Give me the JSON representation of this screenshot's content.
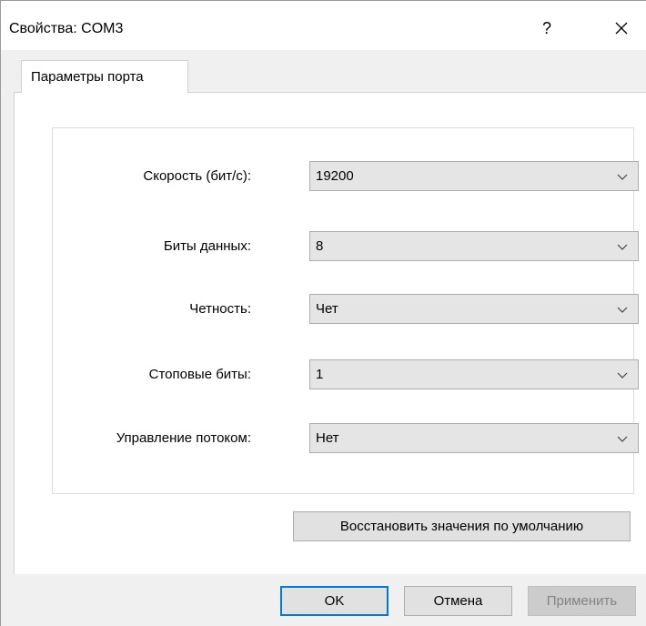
{
  "window": {
    "title": "Свойства: COM3",
    "help_label": "?",
    "close_label": "✕"
  },
  "tabs": [
    {
      "label": "Параметры порта",
      "active": true
    }
  ],
  "port_settings": {
    "fields": [
      {
        "label": "Скорость (бит/с):",
        "value": "19200"
      },
      {
        "label": "Биты данных:",
        "value": "8"
      },
      {
        "label": "Четность:",
        "value": "Чет"
      },
      {
        "label": "Стоповые биты:",
        "value": "1"
      },
      {
        "label": "Управление потоком:",
        "value": "Нет"
      }
    ],
    "restore_defaults_label": "Восстановить значения по умолчанию"
  },
  "footer": {
    "ok_label": "OK",
    "cancel_label": "Отмена",
    "apply_label": "Применить"
  },
  "colors": {
    "accent": "#0078d7",
    "dialog_bg": "#f0f0f0",
    "panel_bg": "#ffffff",
    "combo_bg": "#e5e5e5",
    "disabled_text": "#838383"
  },
  "icons": {
    "help": "question-mark-icon",
    "close": "close-icon",
    "combo_arrow": "chevron-down-icon"
  }
}
